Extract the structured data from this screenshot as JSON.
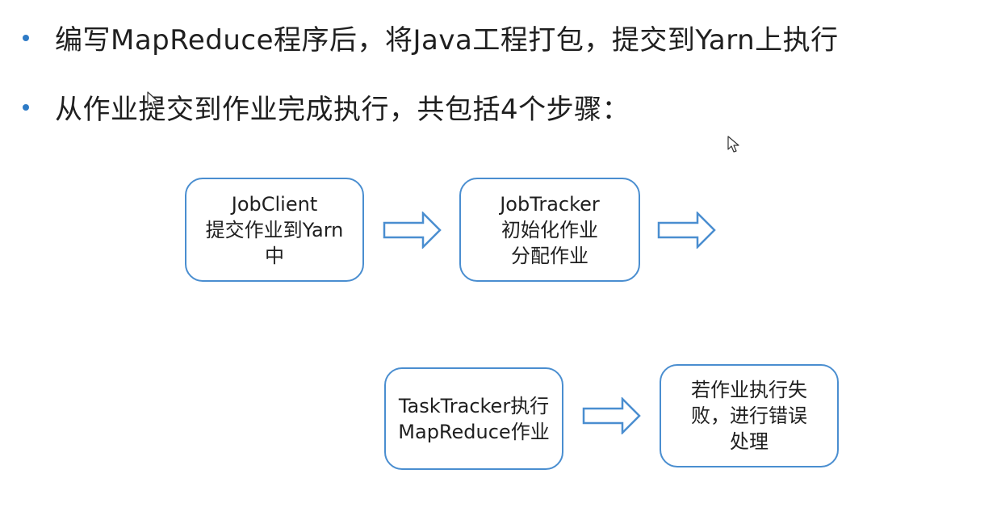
{
  "bullets": [
    "编写MapReduce程序后，将Java工程打包，提交到Yarn上执行",
    "从作业提交到作业完成执行，共包括4个步骤："
  ],
  "steps": [
    {
      "lines": [
        "JobClient",
        "提交作业到Yarn",
        "中"
      ]
    },
    {
      "lines": [
        "JobTracker",
        "初始化作业",
        "分配作业"
      ]
    },
    {
      "lines": [
        "TaskTracker执行",
        "MapReduce作业"
      ]
    },
    {
      "lines": [
        "若作业执行失",
        "败，进行错误",
        "处理"
      ]
    }
  ],
  "colors": {
    "bullet": "#2e7bc6",
    "box_border": "#4a8ed0",
    "arrow_stroke": "#4a8ed0"
  }
}
